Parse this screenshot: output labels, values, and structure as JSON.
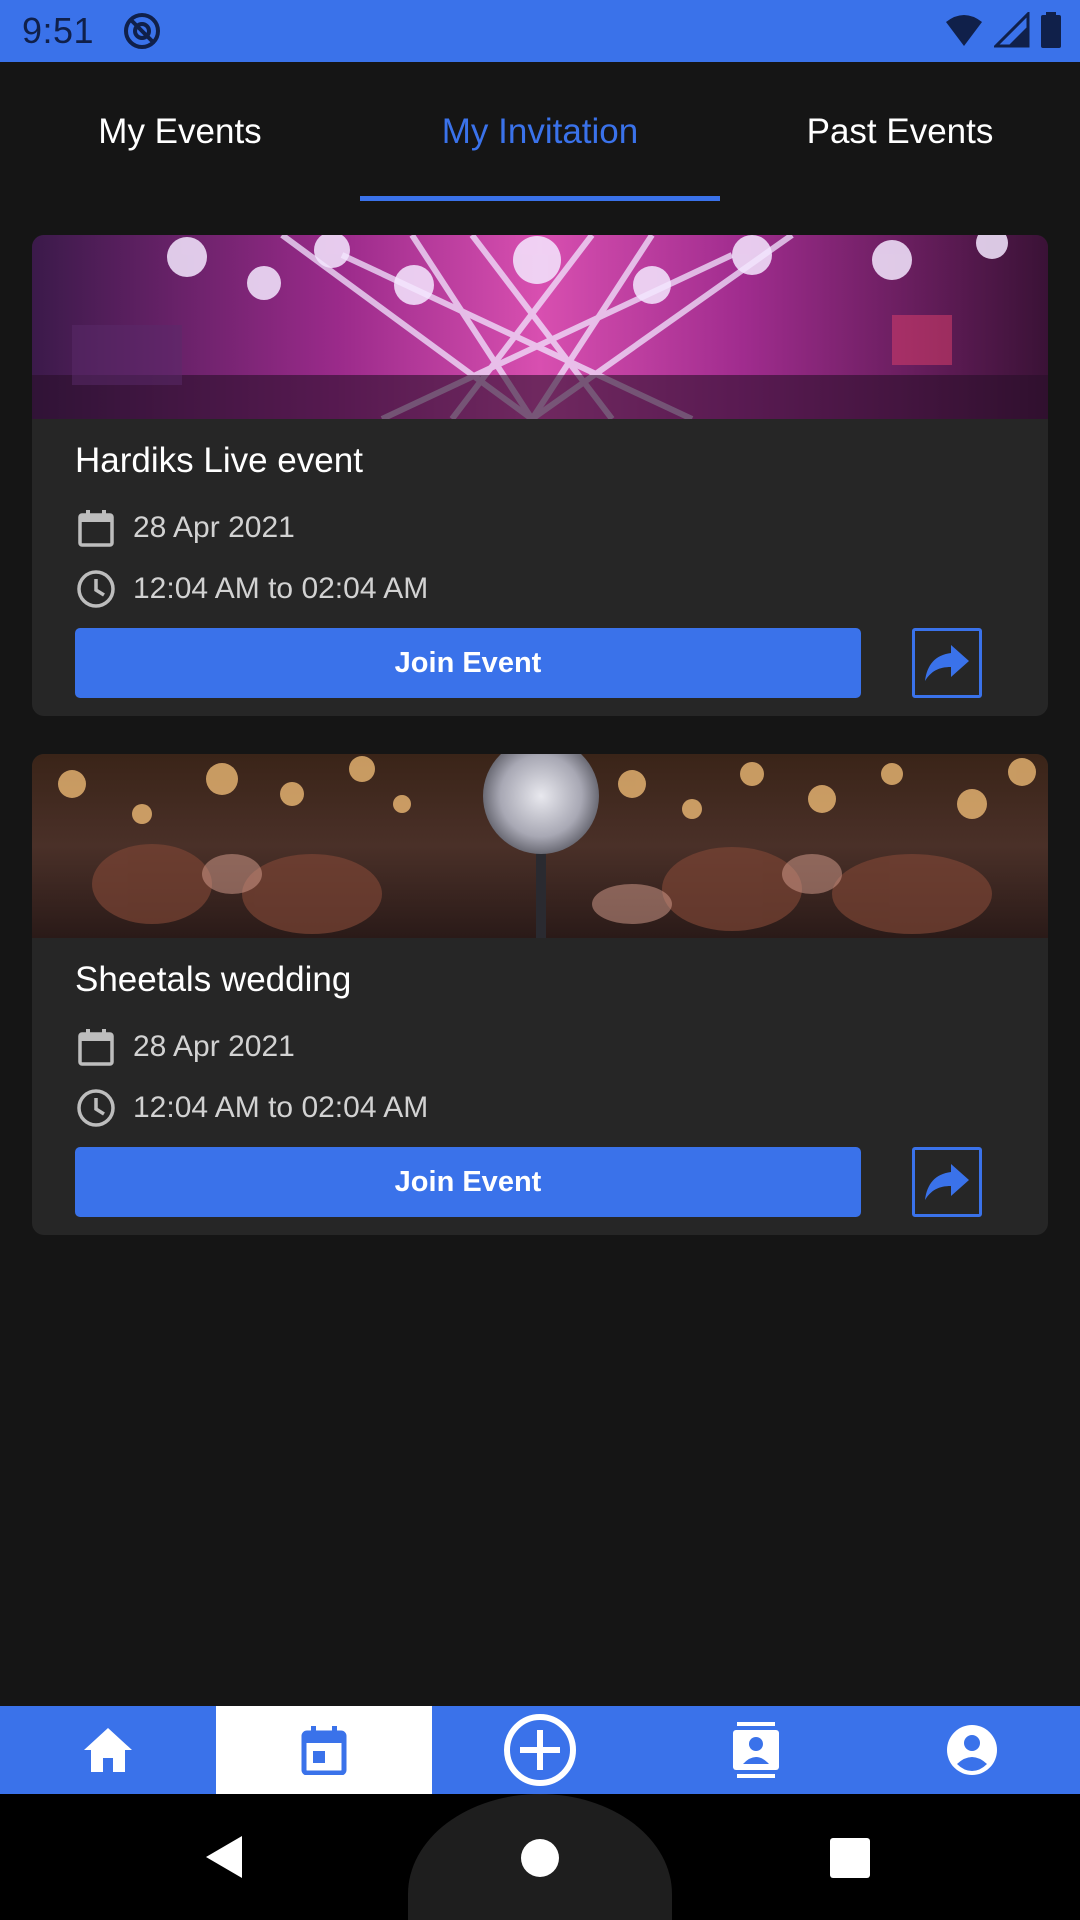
{
  "status_bar": {
    "time": "9:51",
    "icons": [
      "at-sign-icon",
      "wifi-icon",
      "signal-icon",
      "battery-icon"
    ]
  },
  "tabs": [
    {
      "label": "My Events",
      "active": false
    },
    {
      "label": "My Invitation",
      "active": true
    },
    {
      "label": "Past Events",
      "active": false
    }
  ],
  "events": [
    {
      "title": "Hardiks Live event",
      "date": "28 Apr 2021",
      "time": "12:04 AM to 02:04 AM",
      "join_label": "Join Event",
      "image": "concert-stage-lights"
    },
    {
      "title": "Sheetals wedding",
      "date": "28 Apr 2021",
      "time": "12:04 AM to 02:04 AM",
      "join_label": "Join Event",
      "image": "microphone-crowd-bokeh"
    }
  ],
  "bottom_nav": [
    {
      "icon": "home-icon",
      "active": false
    },
    {
      "icon": "calendar-icon",
      "active": true
    },
    {
      "icon": "add-circle-icon",
      "active": false
    },
    {
      "icon": "contacts-icon",
      "active": false
    },
    {
      "icon": "account-icon",
      "active": false
    }
  ],
  "colors": {
    "accent": "#3a72ea",
    "background": "#151515",
    "card": "#262626"
  }
}
